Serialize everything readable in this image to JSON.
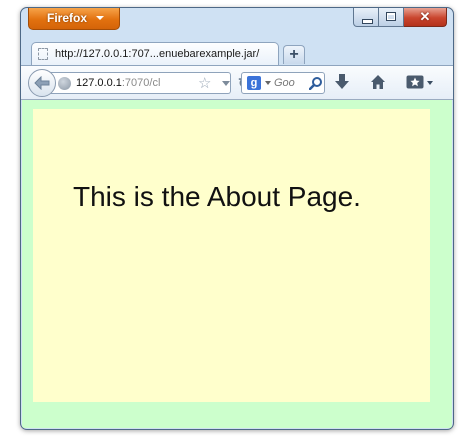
{
  "window": {
    "app_button_label": "Firefox",
    "caption": {
      "close_glyph": "✕"
    }
  },
  "tabs": [
    {
      "title": "http://127.0.0.1:707...enuebarexample.jar/"
    }
  ],
  "new_tab_label": "+",
  "navbar": {
    "url_host": "127.0.0.1",
    "url_rest": ":7070/cl",
    "search_placeholder": "Goo"
  },
  "page": {
    "heading": "This is the About Page.",
    "outer_bg": "#ccffcc",
    "inner_bg": "#ffffcc"
  }
}
